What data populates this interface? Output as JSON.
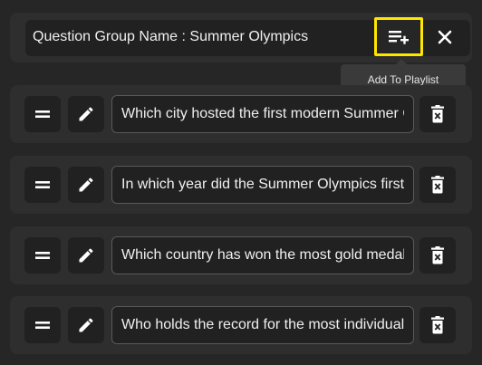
{
  "header": {
    "title": "Question Group Name : Summer Olympics",
    "add_playlist_icon": "playlist-add-icon",
    "close_icon": "close-icon",
    "tooltip": "Add To Playlist",
    "highlight_color": "#ffe600"
  },
  "questions": [
    {
      "text": "Which city hosted the first modern Summer Olympics?"
    },
    {
      "text": "In which year did the Summer Olympics first include women?"
    },
    {
      "text": "Which country has won the most gold medals in Summer Olympics history?"
    },
    {
      "text": "Who holds the record for the most individual Olympic medals?"
    }
  ],
  "row_icons": {
    "drag": "drag-handle-icon",
    "edit": "pencil-icon",
    "delete": "trash-icon"
  },
  "colors": {
    "background": "#262626",
    "card": "#2e2e2e",
    "control": "#212121",
    "text": "#f0f0f0"
  }
}
